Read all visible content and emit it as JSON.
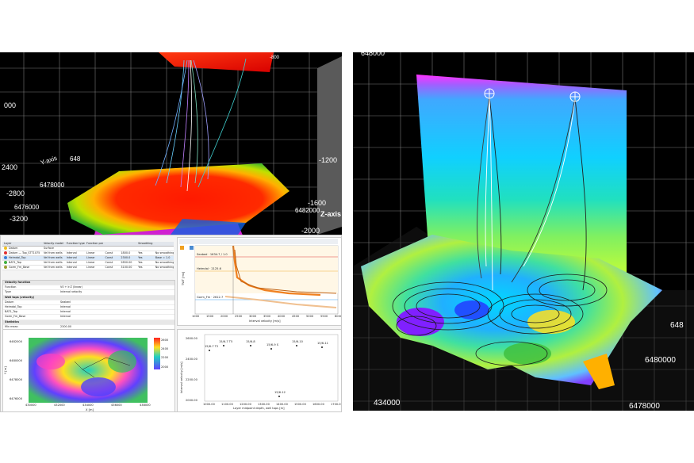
{
  "top_left_3d": {
    "axis_labels": {
      "y": "Y-axis",
      "z": "Z-axis"
    },
    "ticks_left": [
      "000",
      "2400",
      "-2800",
      "-3200"
    ],
    "ticks_right": [
      "-1200",
      "-1600",
      "-2000"
    ],
    "ticks_y": [
      "648",
      "6478000",
      "6476000"
    ],
    "tick_bottom": "6482000",
    "tick_top_right": "-800"
  },
  "right_3d": {
    "tick_top_left": "648000",
    "tick_right_mid": "648",
    "tick_right_low": "6480000",
    "tick_bottom_right": "6478000",
    "tick_bottom_left": "434000"
  },
  "settings_table": {
    "headers": [
      "Layer",
      "Velocity model",
      "Function type",
      "Function parameters",
      "",
      "",
      "Smoothing",
      ""
    ],
    "rows": [
      {
        "cells": [
          "Datum",
          "Surface",
          "",
          "",
          "",
          "",
          "",
          ""
        ],
        "color": "#f0c020"
      },
      {
        "cells": [
          "Datum — Top_STT1075",
          "Vel from wells",
          "Interval",
          "Linear",
          "Const",
          "1800.0",
          "Yes",
          "No smoothing"
        ],
        "color": "#e23030"
      },
      {
        "cells": [
          "Heimdal_Top",
          "Vel from wells",
          "Interval",
          "Linear",
          "Const",
          "2300.0",
          "Yes",
          "Base = 1.0"
        ],
        "color": "#3a80d8"
      },
      {
        "cells": [
          "BAT1_Top",
          "Vel from wells",
          "Interval",
          "Linear",
          "Const",
          "2850.00",
          "Yes",
          "No smoothing"
        ],
        "color": "#40b040"
      },
      {
        "cells": [
          "Gorm_Fm_Base",
          "Vel from wells",
          "Interval",
          "Linear",
          "Const",
          "3100.00",
          "Yes",
          "No smoothing"
        ],
        "color": "#9a9a30"
      }
    ]
  },
  "properties": {
    "sec1": "Velocity function",
    "rows1": [
      {
        "k": "Function",
        "v": "V0 + k·Z (linear)"
      },
      {
        "k": "Type",
        "v": "Interval velocity"
      }
    ],
    "sec2": "Well tops (velocity)",
    "rows2": [
      {
        "k": "Datum",
        "v": "Seabed"
      },
      {
        "k": "Heimdal_Top",
        "v": "Interval"
      },
      {
        "k": "BAT1_Top",
        "v": "Interval"
      },
      {
        "k": "Gorm_Fm_Base",
        "v": "Interval"
      }
    ],
    "sec3": "Statistics",
    "rows3": [
      {
        "k": "Min mean",
        "v": "2300.00"
      },
      {
        "k": "Max mean",
        "v": "3100.00"
      }
    ]
  },
  "log_plot": {
    "ylabel": "TWT [ms]",
    "xlabel": "Interval velocity [m/s]",
    "xticks": [
      "1000",
      "1500",
      "2000",
      "2500",
      "3000",
      "3500",
      "4000",
      "4500",
      "5000",
      "5500",
      "6000"
    ],
    "curve_labels": [
      "Seabed · 1634.7 / 1.0",
      "Heimdal · 2125.6",
      "Gorm_Fm · 2612.7"
    ]
  },
  "map": {
    "ylabel": "Y [m]",
    "xlabel": "X [m]",
    "yticks": [
      "6482000",
      "6480000",
      "6478000",
      "6476000"
    ],
    "xticks": [
      "430000",
      "432000",
      "434000",
      "436000",
      "438000"
    ],
    "colorbar": [
      "2600",
      "2400",
      "2200",
      "2000"
    ]
  },
  "scatter": {
    "ylabel": "Interval velocity [m/s]",
    "xlabel": "Layer midpoint depth, well tops [m]",
    "yticks": [
      "2600.00",
      "2400.00",
      "2200.00",
      "2000.00"
    ],
    "xticks": [
      "1000.00",
      "1100.00",
      "1200.00",
      "1300.00",
      "1400.00",
      "1500.00",
      "1600.00",
      "1700.00"
    ],
    "point_labels": [
      "15/6-7 T2",
      "15/6-7 T5",
      "15/6-8",
      "15/6-9 S",
      "15/6-10",
      "15/6-11",
      "15/6-12"
    ]
  }
}
